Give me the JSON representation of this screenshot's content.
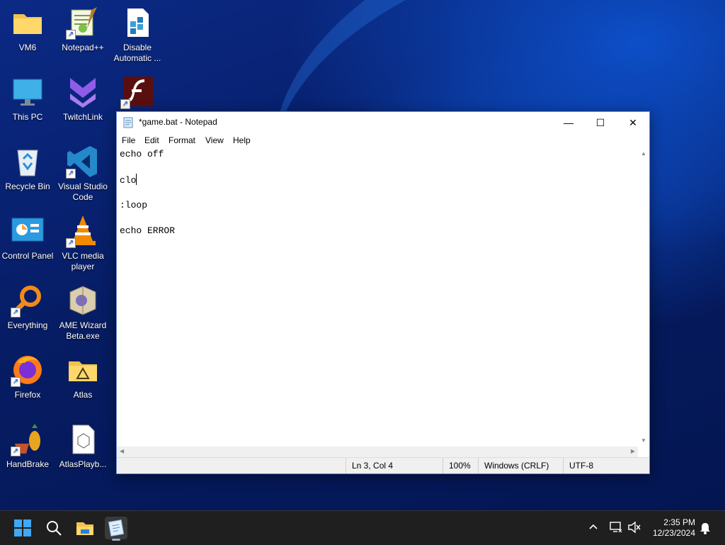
{
  "desktop": {
    "icons": [
      {
        "label": "VM6",
        "icon": "folder-icon"
      },
      {
        "label": "Notepad++",
        "icon": "notepadplusplus-icon"
      },
      {
        "label": "Disable Automatic ...",
        "icon": "disable-updates-icon"
      },
      {
        "label": "This PC",
        "icon": "monitor-icon"
      },
      {
        "label": "TwitchLink",
        "icon": "twitchlink-icon"
      },
      {
        "label": "",
        "icon": "flash-player-icon"
      },
      {
        "label": "Recycle Bin",
        "icon": "recycle-bin-icon"
      },
      {
        "label": "Visual Studio Code",
        "icon": "vscode-icon"
      },
      {
        "label": "Control Panel",
        "icon": "control-panel-icon"
      },
      {
        "label": "VLC media player",
        "icon": "vlc-icon"
      },
      {
        "label": "Everything",
        "icon": "everything-search-icon"
      },
      {
        "label": "AME Wizard Beta.exe",
        "icon": "ame-wizard-icon"
      },
      {
        "label": "Firefox",
        "icon": "firefox-icon"
      },
      {
        "label": "Atlas",
        "icon": "atlas-folder-icon"
      },
      {
        "label": "HandBrake",
        "icon": "handbrake-icon"
      },
      {
        "label": "AtlasPlayb...",
        "icon": "atlas-playbook-icon"
      }
    ]
  },
  "notepad": {
    "title": "*game.bat - Notepad",
    "menu": [
      "File",
      "Edit",
      "Format",
      "View",
      "Help"
    ],
    "lines": [
      "echo off",
      "",
      "clo",
      "",
      ":loop",
      "",
      "echo ERROR"
    ],
    "status": {
      "position": "Ln 3, Col 4",
      "zoom": "100%",
      "line_ending": "Windows (CRLF)",
      "encoding": "UTF-8"
    },
    "window_buttons": {
      "minimize": "—",
      "maximize": "☐",
      "close": "✕"
    }
  },
  "taskbar": {
    "items": [
      "start-icon",
      "search-icon",
      "file-explorer-icon",
      "notepad-icon"
    ],
    "tray": [
      "chevron-up-icon",
      "network-icon",
      "volume-muted-icon",
      "notification-bell-icon"
    ],
    "time": "2:35 PM",
    "date": "12/23/2024"
  }
}
